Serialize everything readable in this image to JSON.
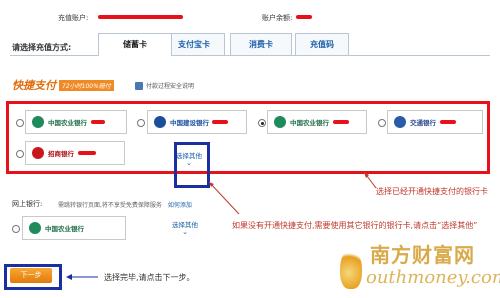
{
  "account": {
    "label": "充值账户:",
    "balance_label": "账户余额:"
  },
  "method_label": "请选择充值方式:",
  "tabs": [
    {
      "label": "储蓄卡"
    },
    {
      "label": "支付宝卡"
    },
    {
      "label": "消费卡"
    },
    {
      "label": "充值码"
    }
  ],
  "quickpay": {
    "logo": "快捷支付",
    "slogan": "72小时100%赔付",
    "safety_link": "付款过程安全说明"
  },
  "banks": [
    {
      "name": "中国农业银行"
    },
    {
      "name": "中国建设银行"
    },
    {
      "name": "中国农业银行"
    },
    {
      "name": "交通银行"
    },
    {
      "name": "招商银行"
    }
  ],
  "select_other": "选择其他",
  "online_bank": {
    "label": "网上银行:",
    "note": "需跳转银行页面,将不享受免费保障服务",
    "link": "如何添加",
    "bank": "中国农业银行",
    "select_other": "选择其他"
  },
  "next_button": "下一步",
  "annotations": {
    "bound": "选择已经开通快捷支付的银行卡",
    "other": "如果没有开通快捷支付,需要使用其它银行的银行卡,请点击“选择其他”",
    "finish": "选择完毕,请点击下一步。"
  },
  "watermark": {
    "cn": "南方财富网",
    "en": "outhmoney.com"
  },
  "colors": {
    "red": "#e8101a",
    "blue": "#1a2fa0",
    "tab_text": "#1c5fa8"
  }
}
